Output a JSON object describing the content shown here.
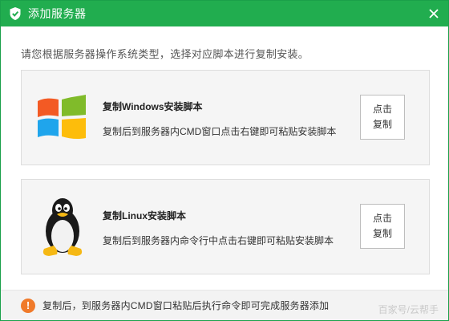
{
  "window": {
    "title": "添加服务器",
    "accent_color": "#21ad4f"
  },
  "instruction": "请您根据服务器操作系统类型，选择对应脚本进行复制安装。",
  "cards": [
    {
      "os_icon": "windows-logo-icon",
      "title": "复制Windows安装脚本",
      "description": "复制后到服务器内CMD窗口点击右键即可粘贴安装脚本",
      "button_line1": "点击",
      "button_line2": "复制"
    },
    {
      "os_icon": "linux-tux-icon",
      "title": "复制Linux安装脚本",
      "description": "复制后到服务器内命令行中点击右键即可粘贴安装脚本",
      "button_line1": "点击",
      "button_line2": "复制"
    }
  ],
  "footer": {
    "icon": "warning-icon",
    "icon_color": "#f07a2a",
    "text": "复制后，到服务器内CMD窗口粘贴后执行命令即可完成服务器添加",
    "watermark": "百家号/云帮手"
  }
}
